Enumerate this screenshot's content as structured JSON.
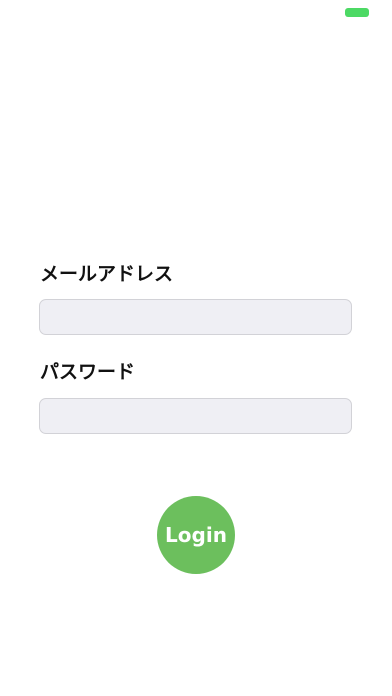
{
  "status_bar": {
    "battery_color": "#4cd964"
  },
  "form": {
    "email_label": "メールアドレス",
    "email_value": "",
    "password_label": "パスワード",
    "password_value": "",
    "login_label": "Login",
    "login_color": "#6cbf5d",
    "field_background": "#efeff4"
  }
}
